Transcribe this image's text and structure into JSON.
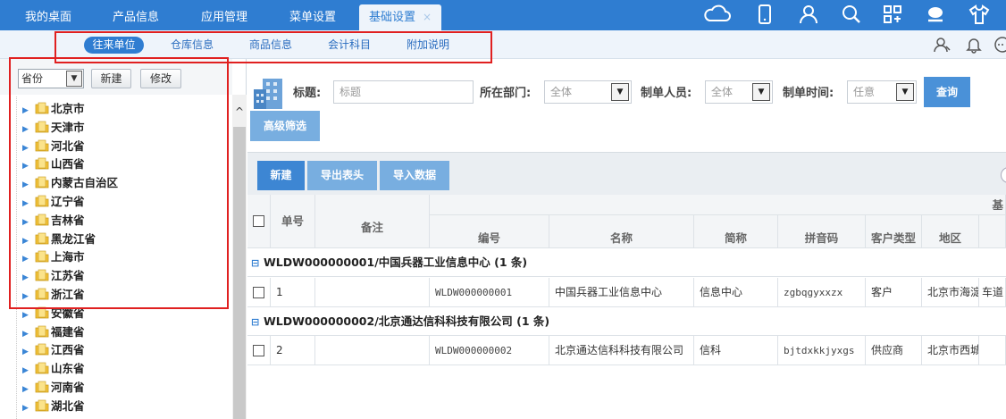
{
  "topbar": {
    "tabs": [
      {
        "label": "我的桌面"
      },
      {
        "label": "产品信息"
      },
      {
        "label": "应用管理"
      },
      {
        "label": "菜单设置"
      },
      {
        "label": "基础设置",
        "close": "×"
      }
    ]
  },
  "subtabs": [
    "往来单位",
    "仓库信息",
    "商品信息",
    "会计科目",
    "附加说明"
  ],
  "leftpanel": {
    "select_value": "省份",
    "new_label": "新建",
    "edit_label": "修改",
    "tree": [
      "北京市",
      "天津市",
      "河北省",
      "山西省",
      "内蒙古自治区",
      "辽宁省",
      "吉林省",
      "黑龙江省",
      "上海市",
      "江苏省",
      "浙江省",
      "安徽省",
      "福建省",
      "江西省",
      "山东省",
      "河南省",
      "湖北省"
    ]
  },
  "filter": {
    "title_label": "标题:",
    "title_placeholder": "标题",
    "dept_label": "所在部门:",
    "dept_value": "全体",
    "maker_label": "制单人员:",
    "maker_value": "全体",
    "time_label": "制单时间:",
    "time_value": "任意",
    "query_label": "查询",
    "advanced_label": "高级筛选"
  },
  "toolbar": {
    "new_label": "新建",
    "export_label": "导出表头",
    "import_label": "导入数据"
  },
  "grid": {
    "top_header_fragment": "基",
    "headers": [
      "单号",
      "备注",
      "编号",
      "名称",
      "简称",
      "拼音码",
      "客户类型",
      "地区"
    ],
    "groups": [
      {
        "title": "WLDW000000001/中国兵器工业信息中心 (1 条)",
        "row": {
          "no": "1",
          "remark": "",
          "code": "WLDW000000001",
          "name": "中国兵器工业信息中心",
          "short": "信息中心",
          "pinyin": "zgbqgyxxzx",
          "ctype": "客户",
          "region": "北京市海淀",
          "extra": "车道"
        }
      },
      {
        "title": "WLDW000000002/北京通达信科科技有限公司 (1 条)",
        "row": {
          "no": "2",
          "remark": "",
          "code": "WLDW000000002",
          "name": "北京通达信科科技有限公司",
          "short": "信科",
          "pinyin": "bjtdxkkjyxgs",
          "ctype": "供应商",
          "region": "北京市西城",
          "extra": ""
        }
      }
    ]
  },
  "colors": {
    "primary": "#2f7dd1",
    "highlight_box": "#e02020"
  }
}
